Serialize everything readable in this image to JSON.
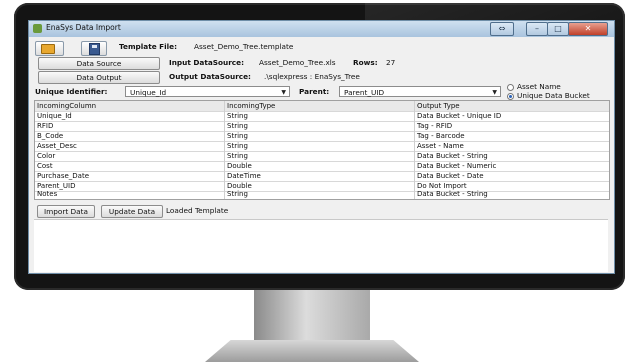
{
  "window": {
    "title": "EnaSys Data Import"
  },
  "toolbar": {
    "template_label": "Template File:",
    "template_value": "Asset_Demo_Tree.template"
  },
  "buttons": {
    "data_source": "Data Source",
    "data_output": "Data Output",
    "import_data": "Import Data",
    "update_data": "Update Data"
  },
  "input": {
    "label": "Input DataSource:",
    "value": "Asset_Demo_Tree.xls",
    "rows_label": "Rows:",
    "rows_value": "27"
  },
  "output": {
    "label": "Output DataSource:",
    "value": ".\\sqlexpress : EnaSys_Tree"
  },
  "unique": {
    "label": "Unique Identifier:",
    "value": "Unique_Id"
  },
  "parent": {
    "label": "Parent:",
    "value": "Parent_UID"
  },
  "radios": {
    "asset_name": "Asset Name",
    "unique_bucket": "Unique Data Bucket",
    "selected": "unique_bucket"
  },
  "grid": {
    "headers": [
      "IncomingColumn",
      "IncomingType",
      "Output Type"
    ],
    "rows": [
      [
        "Unique_Id",
        "String",
        "Data Bucket - Unique ID"
      ],
      [
        "RFID",
        "String",
        "Tag - RFID"
      ],
      [
        "B_Code",
        "String",
        "Tag - Barcode"
      ],
      [
        "Asset_Desc",
        "String",
        "Asset - Name"
      ],
      [
        "Color",
        "String",
        "Data Bucket - String"
      ],
      [
        "Cost",
        "Double",
        "Data Bucket - Numeric"
      ],
      [
        "Purchase_Date",
        "DateTime",
        "Data Bucket - Date"
      ],
      [
        "Parent_UID",
        "Double",
        "Do Not Import"
      ],
      [
        "Notes",
        "String",
        "Data Bucket - String"
      ]
    ]
  },
  "status": {
    "text": "Loaded Template"
  }
}
